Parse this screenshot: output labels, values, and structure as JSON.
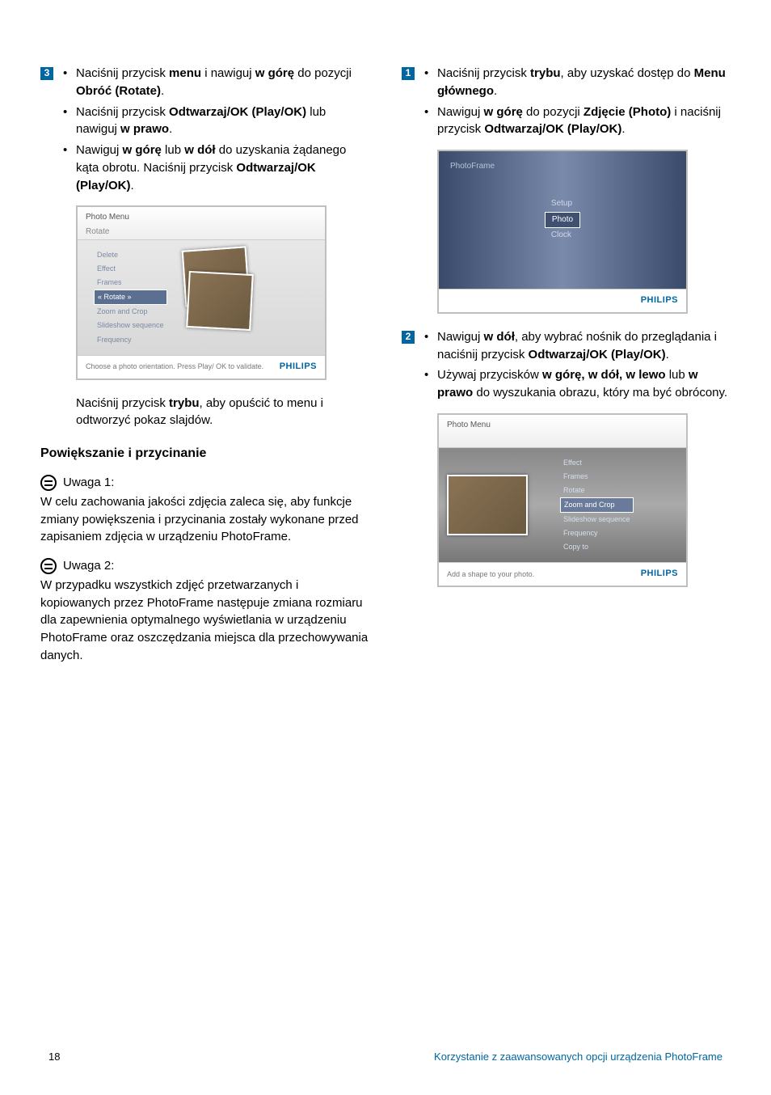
{
  "left": {
    "step3": {
      "badge": "3",
      "b1": {
        "pre": "Naciśnij przycisk ",
        "s1": "menu",
        "mid": " i nawiguj ",
        "s2": "w górę",
        "mid2": " do pozycji ",
        "s3": "Obróć (Rotate)",
        "post": "."
      },
      "b2": {
        "pre": "Naciśnij przycisk ",
        "s1": "Odtwarzaj/OK (Play/OK)",
        "mid": " lub nawiguj ",
        "s2": "w prawo",
        "post": "."
      },
      "b3": {
        "pre": "Nawiguj ",
        "s1": "w górę",
        "mid": " lub ",
        "s2": "w dół",
        "mid2": " do uzyskania żądanego kąta obrotu. Naciśnij przycisk ",
        "s3": "Odtwarzaj/OK (Play/OK)",
        "post": "."
      }
    },
    "mock1": {
      "title": "Photo Menu",
      "sub": "Rotate",
      "items": [
        "Delete",
        "Effect",
        "Frames",
        "« Rotate »",
        "Zoom and Crop",
        "Slideshow sequence",
        "Frequency"
      ],
      "footer": "Choose a photo orientation. Press Play/ OK to validate.",
      "brand": "PHILIPS"
    },
    "afterMock": {
      "pre": "Naciśnij przycisk ",
      "s1": "trybu",
      "post": ", aby opuścić to menu i odtworzyć pokaz slajdów."
    },
    "heading": "Powiększanie i przycinanie",
    "note1": {
      "label": "Uwaga 1:",
      "body": "W celu zachowania jakości zdjęcia zaleca się, aby funkcje zmiany powiększenia i przycinania zostały wykonane przed zapisaniem zdjęcia w urządzeniu PhotoFrame."
    },
    "note2": {
      "label": "Uwaga 2:",
      "body": "W przypadku wszystkich zdjęć przetwarzanych i kopiowanych przez PhotoFrame następuje zmiana rozmiaru dla zapewnienia optymalnego wyświetlania w urządzeniu PhotoFrame oraz oszczędzania miejsca dla przechowywania danych."
    }
  },
  "right": {
    "step1": {
      "badge": "1",
      "b1": {
        "pre": "Naciśnij przycisk ",
        "s1": "trybu",
        "mid": ", aby uzyskać dostęp do ",
        "s2": "Menu głównego",
        "post": "."
      },
      "b2": {
        "pre": "Nawiguj ",
        "s1": "w górę",
        "mid": " do pozycji ",
        "s2": "Zdjęcie (Photo)",
        "mid2": " i naciśnij przycisk ",
        "s3": "Odtwarzaj/OK (Play/OK)",
        "post": "."
      }
    },
    "mock2": {
      "corner": "PhotoFrame",
      "items": [
        "Setup",
        "Photo",
        "Clock"
      ],
      "brand": "PHILIPS"
    },
    "step2": {
      "badge": "2",
      "b1": {
        "pre": "Nawiguj ",
        "s1": "w dół",
        "mid": ", aby wybrać nośnik do przeglądania i naciśnij przycisk ",
        "s2": "Odtwarzaj/OK (Play/OK)",
        "post": "."
      },
      "b2": {
        "pre": "Używaj przycisków ",
        "s1": "w górę, w dół, w lewo",
        "mid": " lub ",
        "s2": "w prawo",
        "post": " do wyszukania obrazu, który ma być obrócony."
      }
    },
    "mock3": {
      "title": "Photo Menu",
      "items": [
        "Effect",
        "Frames",
        "Rotate",
        "Zoom and Crop",
        "Slideshow sequence",
        "Frequency",
        "Copy to"
      ],
      "footer": "Add a shape to your photo.",
      "brand": "PHILIPS"
    }
  },
  "footer": {
    "page": "18",
    "title": "Korzystanie z zaawansowanych opcji urządzenia PhotoFrame"
  }
}
